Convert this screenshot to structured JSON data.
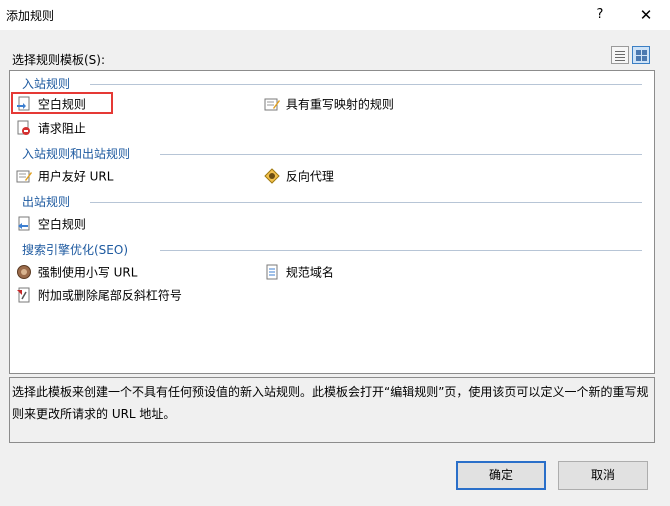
{
  "window": {
    "title": "添加规则",
    "help": "?",
    "close": "✕"
  },
  "selector": {
    "label": "选择规则模板(S):"
  },
  "groups": [
    {
      "header": "入站规则",
      "items": [
        {
          "label": "空白规则",
          "icon": "blank-rule-icon",
          "selected": true
        },
        {
          "label": "具有重写映射的规则",
          "icon": "rewrite-map-icon"
        },
        {
          "label": "请求阻止",
          "icon": "request-block-icon"
        }
      ]
    },
    {
      "header": "入站规则和出站规则",
      "items": [
        {
          "label": "用户友好 URL",
          "icon": "friendly-url-icon"
        },
        {
          "label": "反向代理",
          "icon": "reverse-proxy-icon"
        }
      ]
    },
    {
      "header": "出站规则",
      "items": [
        {
          "label": "空白规则",
          "icon": "outbound-blank-rule-icon"
        }
      ]
    },
    {
      "header": "搜索引擎优化(SEO)",
      "items": [
        {
          "label": "强制使用小写 URL",
          "icon": "lowercase-url-icon"
        },
        {
          "label": "规范域名",
          "icon": "canonical-domain-icon"
        },
        {
          "label": "附加或删除尾部反斜杠符号",
          "icon": "trailing-slash-icon"
        }
      ]
    }
  ],
  "description": "选择此模板来创建一个不具有任何预设值的新入站规则。此模板会打开“编辑规则”页，使用该页可以定义一个新的重写规则来更改所请求的 URL 地址。",
  "buttons": {
    "ok": "确定",
    "cancel": "取消"
  }
}
